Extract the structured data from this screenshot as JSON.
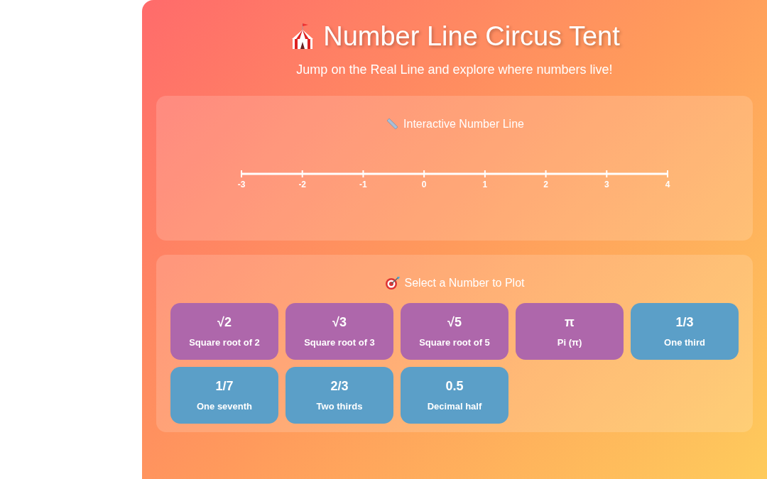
{
  "header": {
    "title": "Number Line Circus Tent",
    "subtitle": "Jump on the Real Line and explore where numbers live!"
  },
  "number_line": {
    "title": "Interactive Number Line",
    "ticks": [
      "-3",
      "-2",
      "-1",
      "0",
      "1",
      "2",
      "3",
      "4"
    ]
  },
  "picker": {
    "title": "Select a Number to Plot",
    "numbers": [
      {
        "symbol": "√2",
        "label": "Square root of 2",
        "kind": "irrational"
      },
      {
        "symbol": "√3",
        "label": "Square root of 3",
        "kind": "irrational"
      },
      {
        "symbol": "√5",
        "label": "Square root of 5",
        "kind": "irrational"
      },
      {
        "symbol": "π",
        "label": "Pi (π)",
        "kind": "irrational"
      },
      {
        "symbol": "1/3",
        "label": "One third",
        "kind": "rational"
      },
      {
        "symbol": "1/7",
        "label": "One seventh",
        "kind": "rational"
      },
      {
        "symbol": "2/3",
        "label": "Two thirds",
        "kind": "rational"
      },
      {
        "symbol": "0.5",
        "label": "Decimal half",
        "kind": "rational"
      }
    ]
  }
}
